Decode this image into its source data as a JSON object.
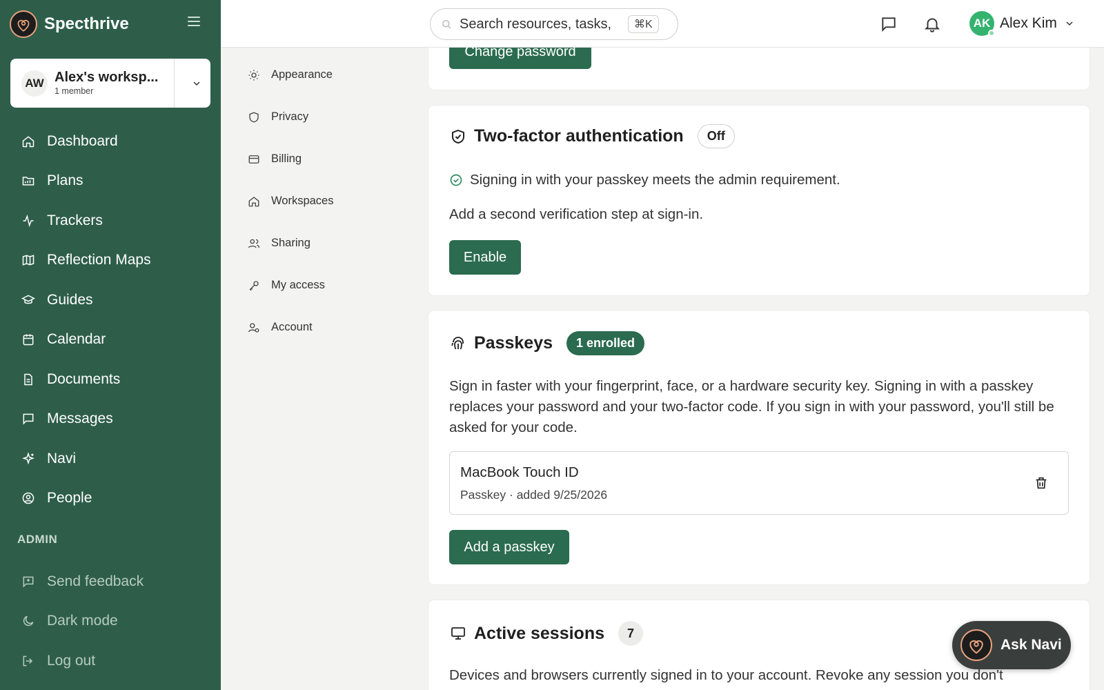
{
  "app": {
    "name": "Specthrive"
  },
  "workspace": {
    "initials": "AW",
    "name": "Alex's worksp...",
    "members": "1 member"
  },
  "sidebar": {
    "items": [
      {
        "label": "Dashboard",
        "icon": "home-icon"
      },
      {
        "label": "Plans",
        "icon": "folder-icon"
      },
      {
        "label": "Trackers",
        "icon": "activity-icon"
      },
      {
        "label": "Reflection Maps",
        "icon": "map-icon"
      },
      {
        "label": "Guides",
        "icon": "graduation-cap-icon"
      },
      {
        "label": "Calendar",
        "icon": "calendar-icon"
      },
      {
        "label": "Documents",
        "icon": "document-icon"
      },
      {
        "label": "Messages",
        "icon": "message-icon"
      },
      {
        "label": "Navi",
        "icon": "sparkle-icon"
      },
      {
        "label": "People",
        "icon": "user-circle-icon"
      }
    ],
    "admin_label": "ADMIN",
    "bottom_items": [
      {
        "label": "Send feedback",
        "icon": "feedback-icon"
      },
      {
        "label": "Dark mode",
        "icon": "moon-icon"
      },
      {
        "label": "Log out",
        "icon": "logout-icon"
      }
    ]
  },
  "topbar": {
    "search_placeholder": "Search resources, tasks,",
    "shortcut": "⌘K",
    "user": {
      "initials": "AK",
      "name": "Alex Kim"
    }
  },
  "settings_nav": [
    {
      "label": "Appearance",
      "icon": "sun-icon"
    },
    {
      "label": "Privacy",
      "icon": "shield-icon"
    },
    {
      "label": "Billing",
      "icon": "credit-card-icon"
    },
    {
      "label": "Workspaces",
      "icon": "home-icon"
    },
    {
      "label": "Sharing",
      "icon": "users-icon"
    },
    {
      "label": "My access",
      "icon": "key-icon"
    },
    {
      "label": "Account",
      "icon": "user-settings-icon"
    }
  ],
  "password": {
    "button": "Change password"
  },
  "two_factor": {
    "title": "Two-factor authentication",
    "status": "Off",
    "notice": "Signing in with your passkey meets the admin requirement.",
    "description": "Add a second verification step at sign-in.",
    "button": "Enable"
  },
  "passkeys": {
    "title": "Passkeys",
    "badge": "1 enrolled",
    "description": "Sign in faster with your fingerprint, face, or a hardware security key. Signing in with a passkey replaces your password and your two-factor code. If you sign in with your password, you'll still be asked for your code.",
    "items": [
      {
        "name": "MacBook Touch ID",
        "meta": "Passkey · added 9/25/2026"
      }
    ],
    "button": "Add a passkey"
  },
  "sessions": {
    "title": "Active sessions",
    "count": "7",
    "description": "Devices and browsers currently signed in to your account. Revoke any session you don't"
  },
  "ask_navi": {
    "label": "Ask Navi"
  },
  "colors": {
    "sidebar": "#2e5e4a",
    "primary": "#2b6b4f",
    "accent": "#e8a27e"
  }
}
